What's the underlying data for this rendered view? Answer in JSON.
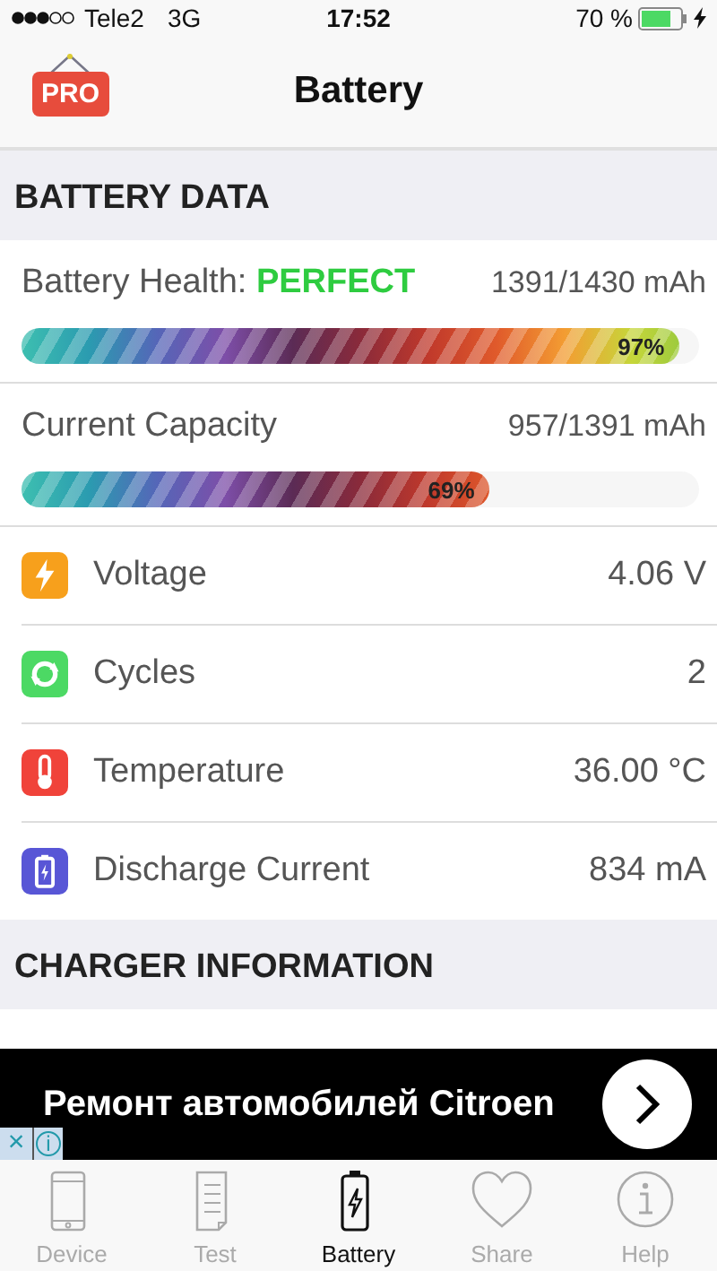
{
  "status_bar": {
    "carrier": "Tele2",
    "network": "3G",
    "time": "17:52",
    "battery_percent": "70 %"
  },
  "nav": {
    "title": "Battery",
    "badge": "PRO"
  },
  "sections": [
    {
      "title": "BATTERY DATA",
      "meters": [
        {
          "label": "Battery Health:",
          "status": "PERFECT",
          "value": "1391/1430 mAh",
          "level": 0.97,
          "reading": "97%"
        },
        {
          "label": "Current Capacity",
          "value": "957/1391 mAh",
          "level": 0.69,
          "reading": "69%"
        }
      ],
      "rows": [
        {
          "kind": "voltage",
          "color": "#f7a01c",
          "label": "Voltage",
          "value": "4.06 V"
        },
        {
          "kind": "cycles",
          "color": "#4cd964",
          "label": "Cycles",
          "value": "2"
        },
        {
          "kind": "temperature",
          "color": "#f0433a",
          "label": "Temperature",
          "value": "36.00 °C"
        },
        {
          "kind": "current",
          "color": "#5856d6",
          "label": "Discharge Current",
          "value": "834 mA"
        }
      ]
    },
    {
      "title": "CHARGER INFORMATION"
    }
  ],
  "ad": {
    "text": "Ремонт автомобилей Citroen",
    "close": "×",
    "info": "i"
  },
  "tabs": [
    {
      "label": "Device",
      "kind": "phone",
      "selected": false
    },
    {
      "label": "Test",
      "kind": "list",
      "selected": false
    },
    {
      "label": "Battery",
      "kind": "battery",
      "selected": true
    },
    {
      "label": "Share",
      "kind": "heart",
      "selected": false
    },
    {
      "label": "Help",
      "kind": "info",
      "selected": false
    }
  ]
}
